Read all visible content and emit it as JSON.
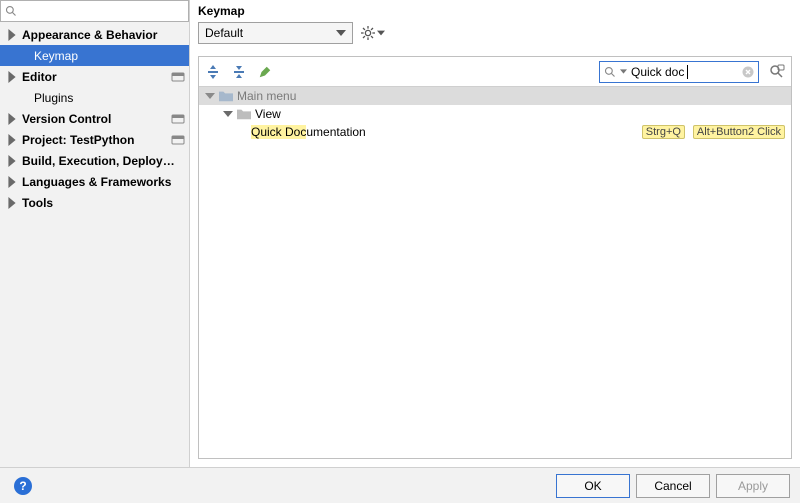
{
  "sidebar": {
    "search_placeholder": "",
    "items": [
      {
        "label": "Appearance & Behavior",
        "expandable": true,
        "depth": 0,
        "bold": true
      },
      {
        "label": "Keymap",
        "expandable": false,
        "depth": 1,
        "selected": true
      },
      {
        "label": "Editor",
        "expandable": true,
        "depth": 0,
        "bold": true,
        "badge": true
      },
      {
        "label": "Plugins",
        "expandable": false,
        "depth": 1
      },
      {
        "label": "Version Control",
        "expandable": true,
        "depth": 0,
        "bold": true,
        "badge": true
      },
      {
        "label": "Project: TestPython",
        "expandable": true,
        "depth": 0,
        "bold": true,
        "badge": true
      },
      {
        "label": "Build, Execution, Deployment",
        "expandable": true,
        "depth": 0,
        "bold": true
      },
      {
        "label": "Languages & Frameworks",
        "expandable": true,
        "depth": 0,
        "bold": true
      },
      {
        "label": "Tools",
        "expandable": true,
        "depth": 0,
        "bold": true
      }
    ]
  },
  "content": {
    "title": "Keymap",
    "scheme_selected": "Default",
    "search_value": "Quick doc",
    "tree": {
      "root_label": "Main menu",
      "view_label": "View",
      "action_prefix_hl": "Quick Doc",
      "action_suffix": "umentation",
      "shortcut_kb": "Strg+Q",
      "shortcut_mouse": "Alt+Button2 Click"
    }
  },
  "buttons": {
    "ok": "OK",
    "cancel": "Cancel",
    "apply": "Apply",
    "help": "?"
  }
}
